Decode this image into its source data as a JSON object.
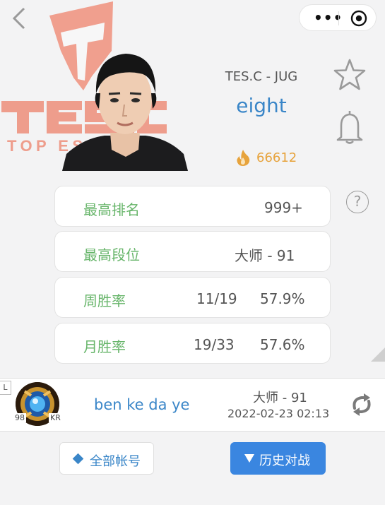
{
  "topbar": {
    "back_icon": "chevron-left-icon",
    "menu_icon": "more-dots-icon",
    "menu_glyph": "•••",
    "target_icon": "target-icon"
  },
  "colors": {
    "accent_blue": "#3a86c8",
    "label_green": "#67b56a",
    "fire_orange": "#e7a33c",
    "logo_salmon": "#ee8f7b",
    "button_blue": "#3a86e0"
  },
  "hero": {
    "logo_text_main": "TES.C",
    "logo_text_sub": "TOP ESPORTS",
    "team_role": "TES.C - JUG",
    "player_name": "eight",
    "fire_count": "66612"
  },
  "help_glyph": "?",
  "stats": [
    {
      "label": "最高排名",
      "value": "999+"
    },
    {
      "label": "最高段位",
      "value": "大师 - 91"
    },
    {
      "label": "周胜率",
      "record": "11/19",
      "rate": "57.9%"
    },
    {
      "label": "月胜率",
      "record": "19/33",
      "rate": "57.6%"
    }
  ],
  "account": {
    "server_tag": "L",
    "level": "98",
    "region": "KR",
    "name": "ben ke da ye",
    "rank": "大师 - 91",
    "updated": "2022-02-23 02:13"
  },
  "buttons": {
    "all_accounts": "全部帐号",
    "match_history": "历史对战"
  }
}
